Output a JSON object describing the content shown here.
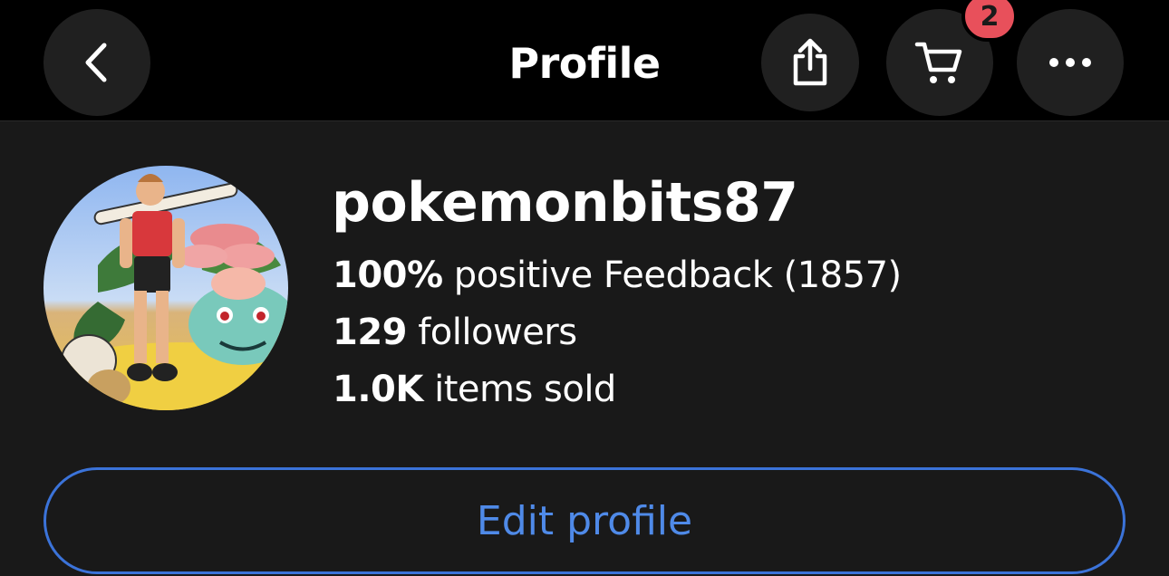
{
  "header": {
    "title": "Profile",
    "cart_count": "2",
    "icons": {
      "back": "chevron-left-icon",
      "share": "share-icon",
      "cart": "cart-icon",
      "more": "more-horizontal-icon"
    }
  },
  "profile": {
    "username": "pokemonbits87",
    "feedback_value": "100%",
    "feedback_label": "positive Feedback (1857)",
    "followers_value": "129",
    "followers_label": "followers",
    "sold_value": "1.0K",
    "sold_label": "items sold",
    "edit_label": "Edit profile"
  },
  "colors": {
    "background": "#191919",
    "topbar": "#000000",
    "badge": "#e8505b",
    "accent": "#4f8ae8"
  }
}
